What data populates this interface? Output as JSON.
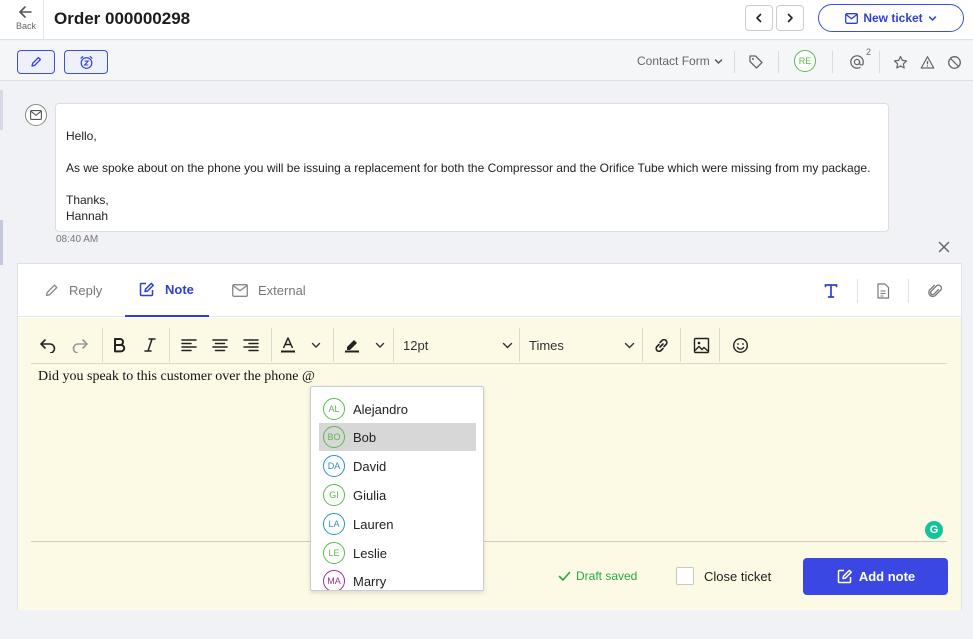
{
  "header": {
    "back_label": "Back",
    "title": "Order 000000298",
    "new_ticket_label": "New ticket"
  },
  "subbar": {
    "contact_form_label": "Contact Form",
    "assignee_initials": "RE",
    "mention_count": "2"
  },
  "message": {
    "lines": [
      "Hello,",
      "As we spoke about on the phone you will be issuing a replacement for both the Compressor and the Orifice Tube which were missing from my package.",
      "Thanks,",
      "Hannah"
    ],
    "time": "08:40 AM"
  },
  "compose": {
    "tabs": [
      {
        "label": "Reply",
        "icon": "pencil-icon"
      },
      {
        "label": "Note",
        "icon": "note-edit-icon",
        "active": true
      },
      {
        "label": "External",
        "icon": "mail-icon"
      }
    ],
    "font_size": "12pt",
    "font_family": "Times",
    "content": "Did you speak to this customer over the phone @",
    "draft_status": "Draft saved",
    "close_ticket_label": "Close ticket",
    "add_note_label": "Add note"
  },
  "mentions": [
    {
      "initials": "AL",
      "name": "Alejandro",
      "color": "#5bb94b"
    },
    {
      "initials": "BO",
      "name": "Bob",
      "color": "#5bb94b",
      "selected": true
    },
    {
      "initials": "DA",
      "name": "David",
      "color": "#2a8fd4"
    },
    {
      "initials": "GI",
      "name": "Giulia",
      "color": "#5bb94b"
    },
    {
      "initials": "LA",
      "name": "Lauren",
      "color": "#2a8fd4"
    },
    {
      "initials": "LE",
      "name": "Leslie",
      "color": "#5bb94b"
    },
    {
      "initials": "MA",
      "name": "Marry",
      "color": "#9b2a9b"
    }
  ],
  "colors": {
    "accent": "#3b47e3",
    "note_background": "#fcf9e5",
    "success": "#27a845"
  }
}
